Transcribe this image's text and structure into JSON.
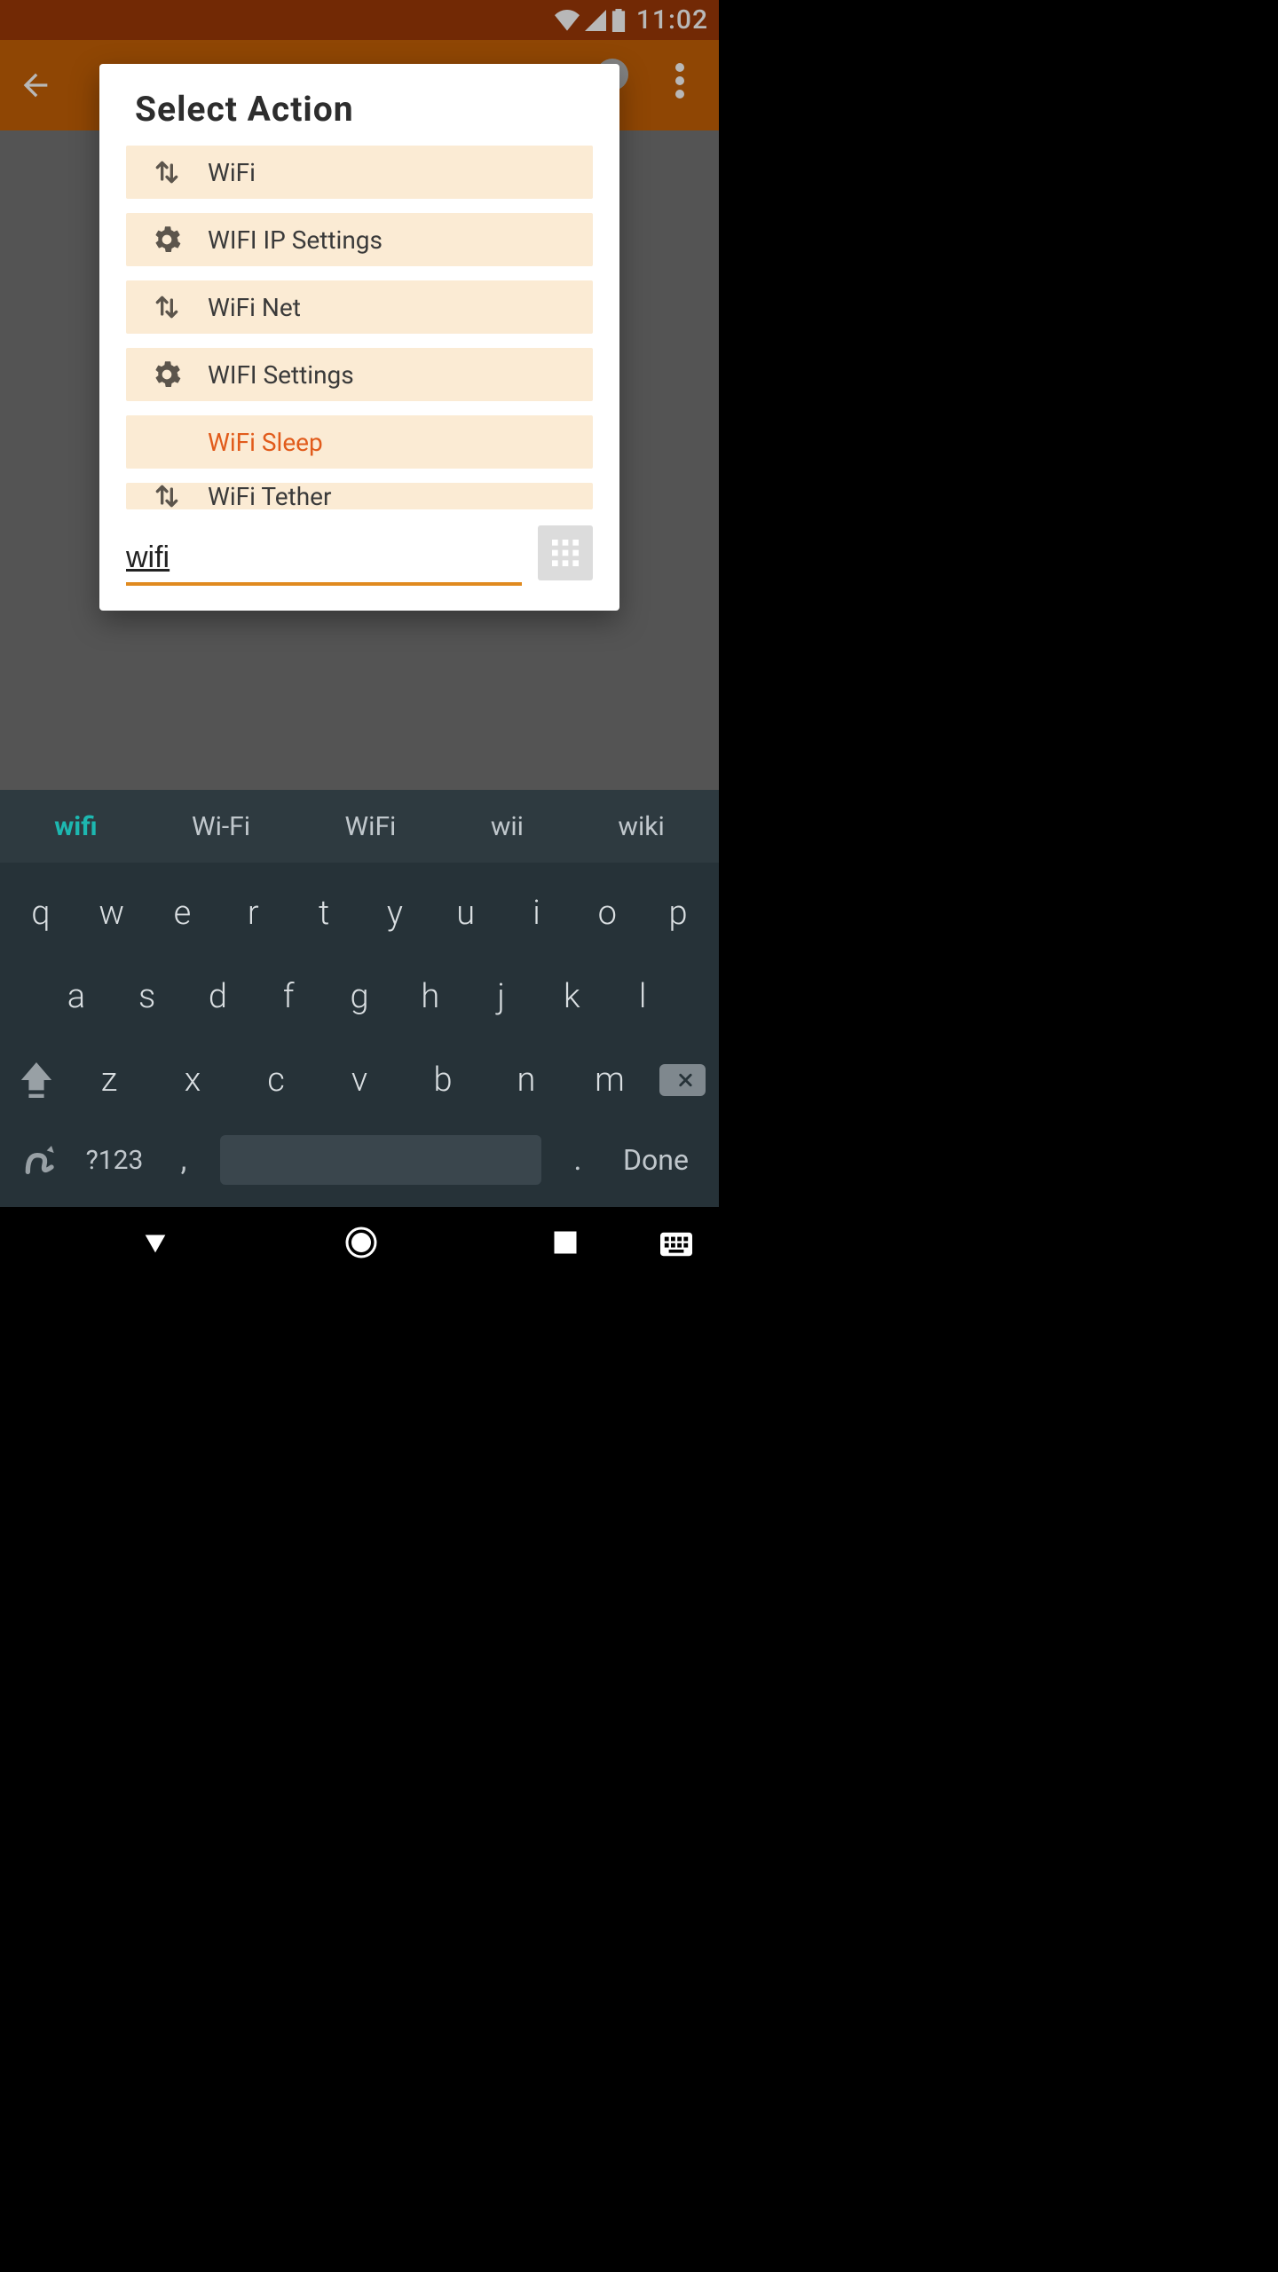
{
  "status": {
    "time": "11:02"
  },
  "dialog": {
    "title": "Select  Action",
    "actions": [
      {
        "icon": "swap",
        "label": "WiFi",
        "accent": false
      },
      {
        "icon": "gear",
        "label": "WIFI IP Settings",
        "accent": false
      },
      {
        "icon": "swap",
        "label": "WiFi Net",
        "accent": false
      },
      {
        "icon": "gear",
        "label": "WIFI Settings",
        "accent": false
      },
      {
        "icon": "",
        "label": "WiFi Sleep",
        "accent": true
      },
      {
        "icon": "swap",
        "label": "WiFi Tether",
        "accent": false,
        "cutoff": true
      }
    ],
    "search_value": "wifi"
  },
  "keyboard": {
    "suggestions": [
      "wifi",
      "Wi-Fi",
      "WiFi",
      "wii",
      "wiki"
    ],
    "active_suggestion_index": 0,
    "row1": [
      "q",
      "w",
      "e",
      "r",
      "t",
      "y",
      "u",
      "i",
      "o",
      "p"
    ],
    "row2": [
      "a",
      "s",
      "d",
      "f",
      "g",
      "h",
      "j",
      "k",
      "l"
    ],
    "row3": [
      "z",
      "x",
      "c",
      "v",
      "b",
      "n",
      "m"
    ],
    "symbols_label": "?123",
    "comma": ",",
    "period": ".",
    "done_label": "Done"
  }
}
